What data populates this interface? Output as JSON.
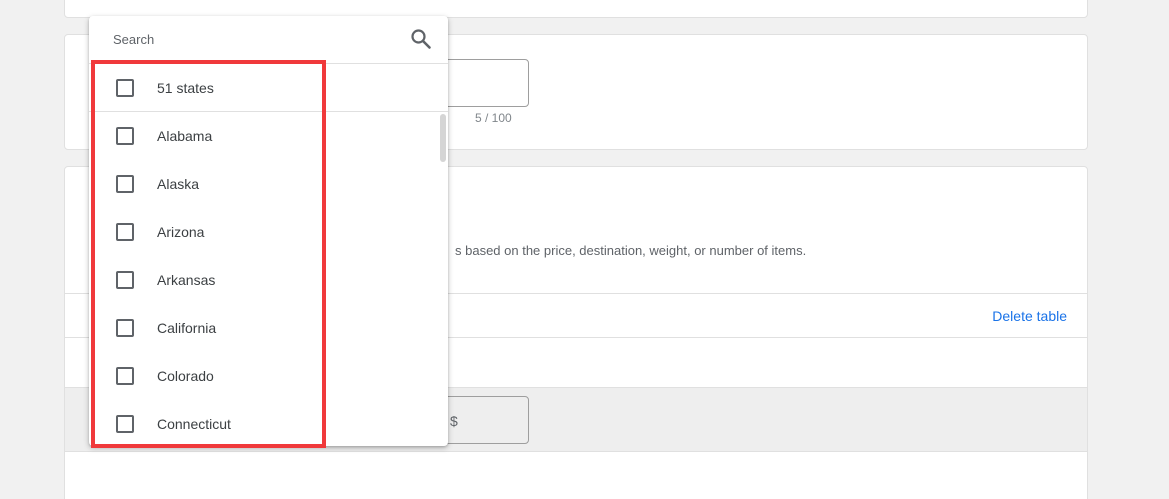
{
  "name_field": {
    "counter": "5 / 100"
  },
  "rates_section": {
    "description": "s based on the price, destination, weight, or number of items.",
    "delete_label": "Delete table",
    "price_prefix": "$"
  },
  "dropdown": {
    "search_placeholder": "Search",
    "items": [
      {
        "label": "51 states",
        "checked": false
      },
      {
        "label": "Alabama",
        "checked": false
      },
      {
        "label": "Alaska",
        "checked": false
      },
      {
        "label": "Arizona",
        "checked": false
      },
      {
        "label": "Arkansas",
        "checked": false
      },
      {
        "label": "California",
        "checked": false
      },
      {
        "label": "Colorado",
        "checked": false
      },
      {
        "label": "Connecticut",
        "checked": false
      }
    ]
  },
  "colors": {
    "highlight": "#f0393b",
    "link": "#1a73e8",
    "background": "#f1f1f1"
  },
  "icons": {
    "search": "search-icon",
    "checkbox": "checkbox-unchecked-icon"
  }
}
